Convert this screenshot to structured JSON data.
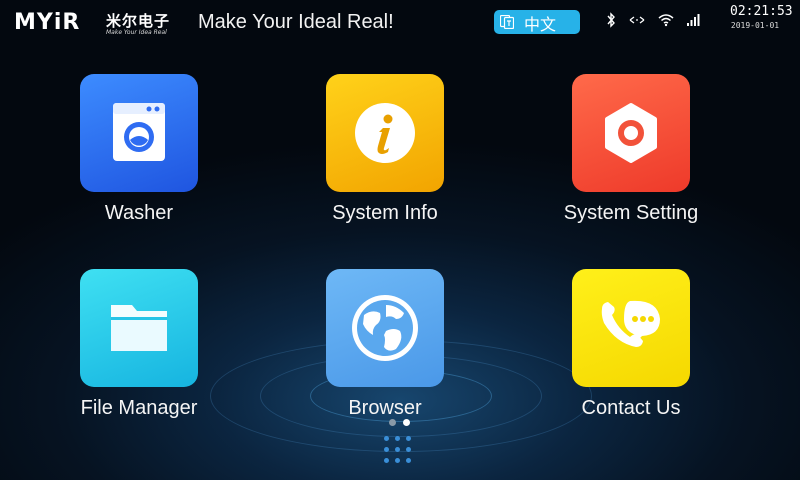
{
  "header": {
    "logo_text": "MYiR",
    "logo_cn": "米尔电子",
    "logo_sub": "Make Your Idea Real",
    "tagline": "Make Your Ideal Real!",
    "language_label": "中文",
    "time": "02:21:53",
    "date": "2019-01-01",
    "status_icons": [
      "bluetooth-icon",
      "network-arrows-icon",
      "wifi-icon",
      "signal-bars-icon"
    ]
  },
  "apps": [
    {
      "label": "Washer",
      "icon": "washing-machine-icon",
      "color": "#2f6cf2"
    },
    {
      "label": "System Info",
      "icon": "info-icon",
      "color": "#f5b20a"
    },
    {
      "label": "System Setting",
      "icon": "settings-hexagon-icon",
      "color": "#f2523a"
    },
    {
      "label": "File Manager",
      "icon": "folder-icon",
      "color": "#23c6e6"
    },
    {
      "label": "Browser",
      "icon": "globe-icon",
      "color": "#5aa8ee"
    },
    {
      "label": "Contact Us",
      "icon": "phone-chat-icon",
      "color": "#f7e500"
    }
  ],
  "pager": {
    "pages": 2,
    "current": 2
  },
  "colors": {
    "accent": "#27b2e8"
  }
}
